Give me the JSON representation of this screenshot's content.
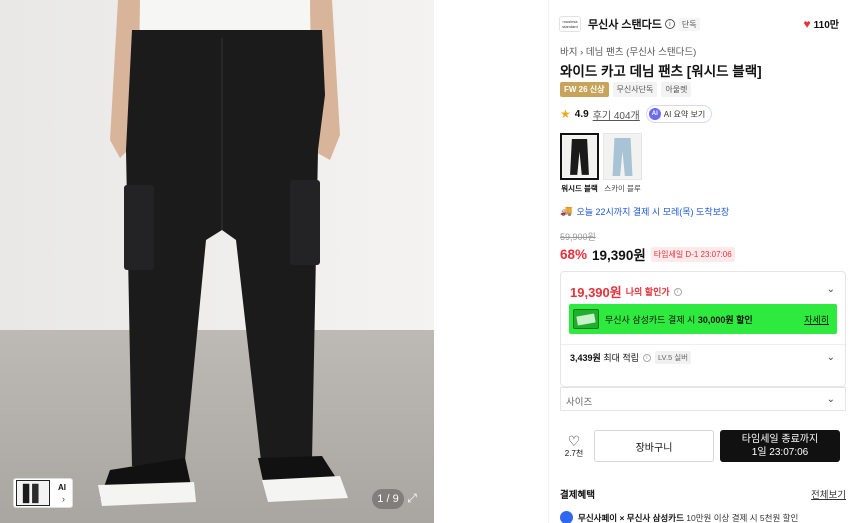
{
  "gallery": {
    "thumb_ai_label": "AI",
    "pager": "1 / 9"
  },
  "brand": {
    "logo_text": "musinsa standard",
    "name": "무신사 스탠다드",
    "exclusive": "단독",
    "likes": "110만"
  },
  "breadcrumb": "바지 › 데님 팬츠 (무신사 스탠다드)",
  "product": {
    "title": "와이드 카고 데님 팬츠 [워시드 블랙]",
    "tags": [
      "FW 26 신상",
      "무신사단독",
      "아울렛"
    ],
    "rating": "4.9",
    "review": "후기 404개",
    "ai_summary": "AI 요약 보기",
    "ai_badge": "AI"
  },
  "swatches": [
    {
      "label": "워시드 블랙",
      "active": true
    },
    {
      "label": "스카이 블루",
      "active": false
    }
  ],
  "delivery": "오늘 22시까지 결제 시 모레(목) 도착보장",
  "pricing": {
    "original": "59,900원",
    "discount": "68%",
    "price": "19,390원",
    "timesale": "타임세일 D-1 23:07:06"
  },
  "my_price": {
    "price": "19,390원",
    "label": "나의 할인가",
    "card_text_prefix": "무신사 삼성카드 결제 시 ",
    "card_text_bold": "30,000원 할인",
    "card_more": "자세히",
    "points_bold": "3,439원",
    "points_text": " 최대 적립",
    "level": "LV.5 실버"
  },
  "size": {
    "placeholder": "사이즈"
  },
  "actions": {
    "like_count": "2.7천",
    "cart": "장바구니",
    "buy_line1": "타임세일 종료까지",
    "buy_line2": "1일 23:07:06"
  },
  "payment": {
    "title": "결제혜택",
    "all": "전체보기",
    "benefit_bold": "무신사페이 × 무신사 삼성카드",
    "benefit_text": " 10만원 이상 결제 시 5천원 할인"
  }
}
